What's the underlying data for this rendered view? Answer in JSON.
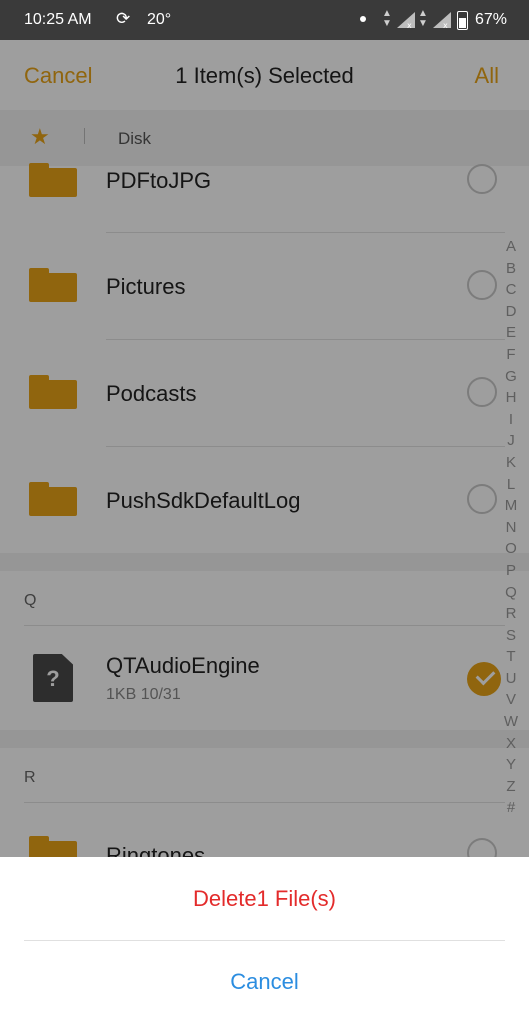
{
  "status_bar": {
    "time": "10:25 AM",
    "temperature": "20°",
    "battery": "67%",
    "sync_icon": "sync-icon",
    "signal_icon": "signal-icon"
  },
  "header": {
    "cancel_label": "Cancel",
    "title": "1 Item(s) Selected",
    "all_label": "All"
  },
  "breadcrumb": {
    "root_icon": "star-icon",
    "location": "Disk"
  },
  "files": [
    {
      "name": "PDFtoJPG",
      "selected": false
    },
    {
      "name": "Pictures",
      "selected": false
    },
    {
      "name": "Podcasts",
      "selected": false
    },
    {
      "name": "PushSdkDefaultLog",
      "selected": false
    },
    {
      "name": "QTAudioEngine",
      "meta": "1KB  10/31",
      "selected": true
    },
    {
      "name": "Ringtones",
      "selected": false
    }
  ],
  "sections": {
    "q": "Q",
    "r": "R"
  },
  "alphabet_index": [
    "A",
    "B",
    "C",
    "D",
    "E",
    "F",
    "G",
    "H",
    "I",
    "J",
    "K",
    "L",
    "M",
    "N",
    "O",
    "P",
    "Q",
    "R",
    "S",
    "T",
    "U",
    "V",
    "W",
    "X",
    "Y",
    "Z",
    "#"
  ],
  "action_sheet": {
    "delete_label": "Delete1 File(s)",
    "cancel_label": "Cancel"
  },
  "colors": {
    "accent": "#e8a317",
    "danger": "#e32b2b",
    "link": "#2b8de0"
  }
}
